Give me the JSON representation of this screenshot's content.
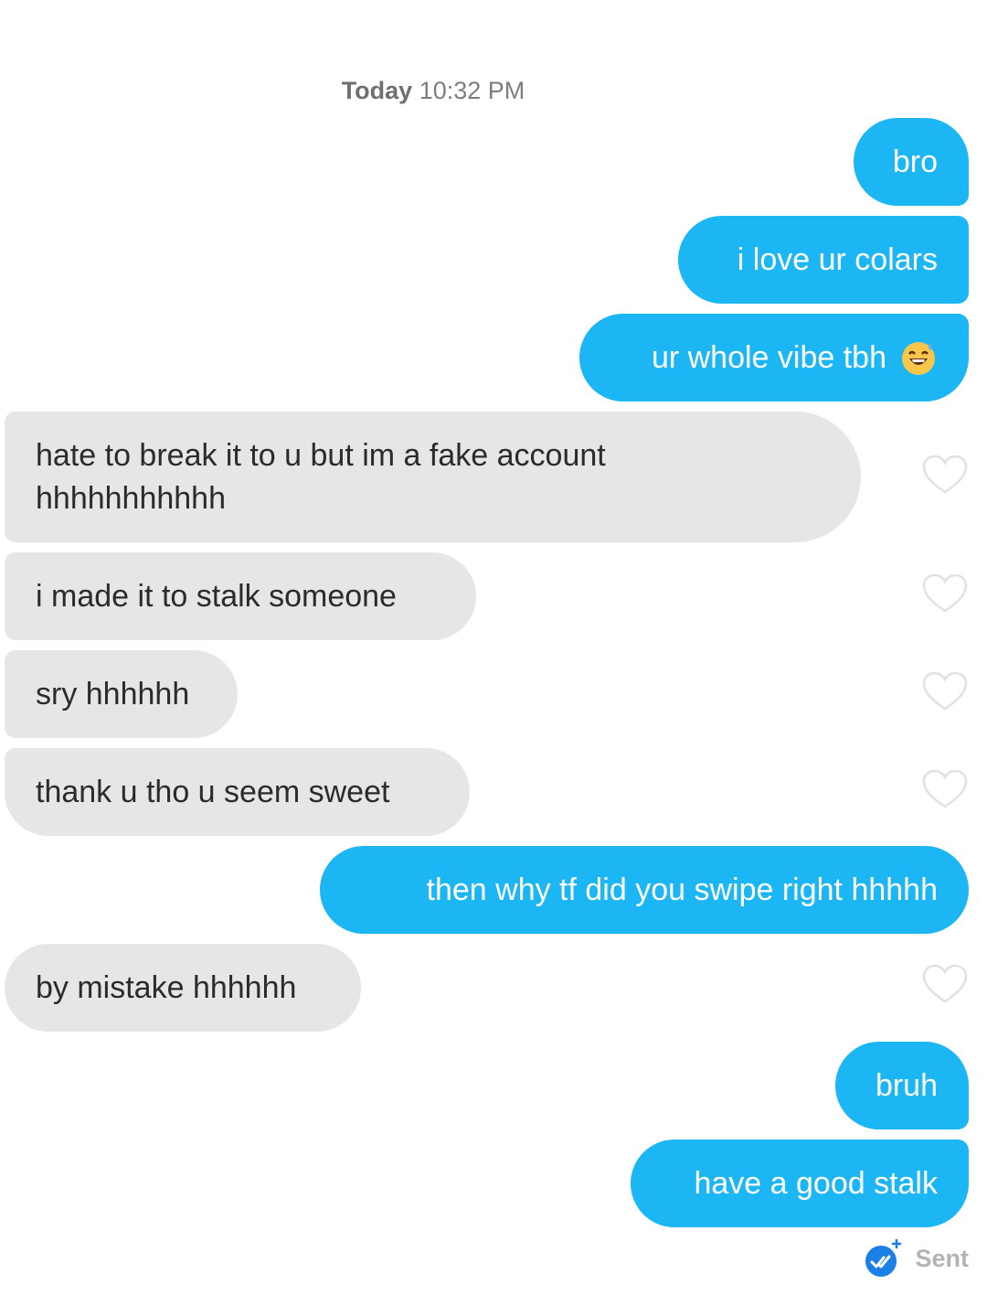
{
  "timestamp": {
    "day": "Today",
    "time": "10:32 PM"
  },
  "messages": [
    {
      "text": "bro",
      "direction": "sent"
    },
    {
      "text": "i love ur colars",
      "direction": "sent"
    },
    {
      "text": "ur whole vibe tbh",
      "direction": "sent",
      "emoji": "grinning-sweat-emoji"
    },
    {
      "text": "hate to break it to u but im a fake account hhhhhhhhhhh",
      "direction": "received"
    },
    {
      "text": "i made it to stalk someone",
      "direction": "received"
    },
    {
      "text": "sry hhhhhh",
      "direction": "received"
    },
    {
      "text": "thank u tho u seem sweet",
      "direction": "received"
    },
    {
      "text": "then why tf did you swipe right hhhhh",
      "direction": "sent"
    },
    {
      "text": "by mistake hhhhhh",
      "direction": "received"
    },
    {
      "text": "bruh",
      "direction": "sent"
    },
    {
      "text": "have a good stalk",
      "direction": "sent"
    }
  ],
  "status": {
    "label": "Sent",
    "icon": "sent-check-icon"
  },
  "colors": {
    "sent_bubble": "#1cb6f5",
    "received_bubble": "#e6e6e6",
    "sent_text": "#ffffff",
    "received_text": "#2b2b2b"
  }
}
